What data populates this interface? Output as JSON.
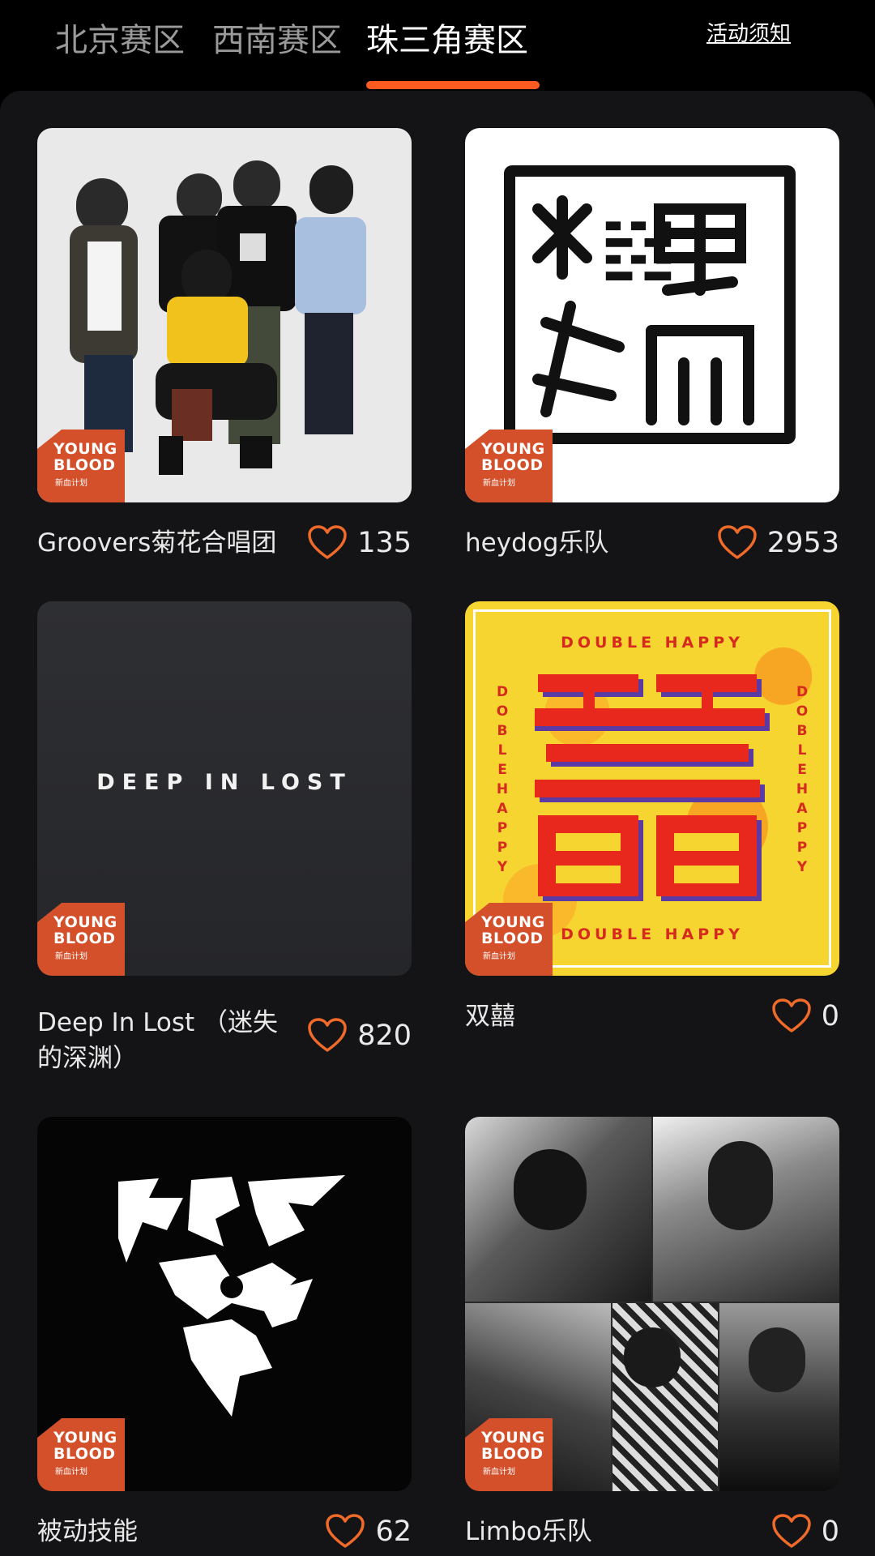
{
  "tabs": [
    {
      "label": "北京赛区",
      "active": false
    },
    {
      "label": "西南赛区",
      "active": false
    },
    {
      "label": "珠三角赛区",
      "active": true
    }
  ],
  "notice_label": "活动须知",
  "accent_color": "#ff5a1f",
  "badge": {
    "line1": "YOUNG",
    "line2": "BLOOD",
    "sub": "新血计划"
  },
  "cards": [
    {
      "title": "Groovers菊花合唱团",
      "likes": "135",
      "icon": "heart-icon"
    },
    {
      "title": "heydog乐队",
      "likes": "2953",
      "icon": "heart-icon"
    },
    {
      "title": "Deep In Lost （迷失的深渊）",
      "likes": "820",
      "icon": "heart-icon",
      "cover_text": "DEEP IN LOST"
    },
    {
      "title": "双囍",
      "likes": "0",
      "icon": "heart-icon",
      "cover_text": "DOUBLE HAPPY",
      "cover_side_text": "DOBLE HAPPY"
    },
    {
      "title": "被动技能",
      "likes": "62",
      "icon": "heart-icon"
    },
    {
      "title": "Limbo乐队",
      "likes": "0",
      "icon": "heart-icon"
    }
  ]
}
